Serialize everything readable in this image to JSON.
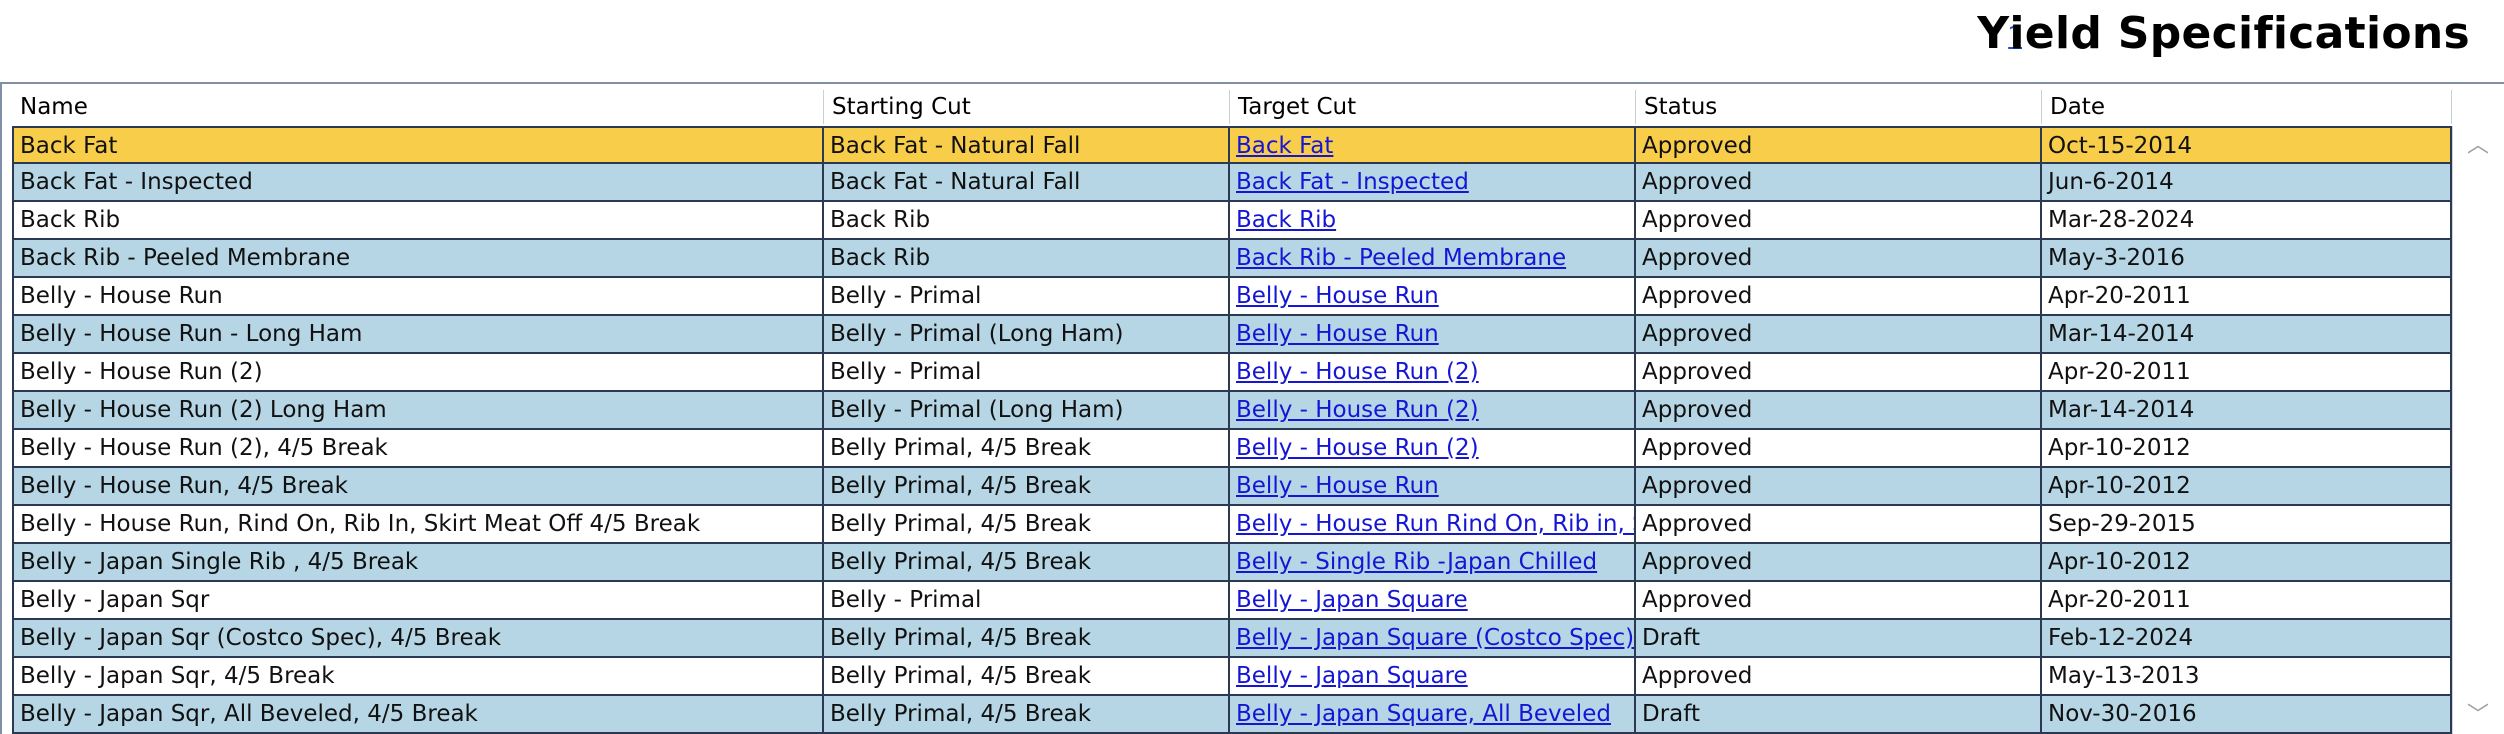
{
  "header": {
    "help_label": "?",
    "title": "Yield Specifications"
  },
  "grid": {
    "columns": [
      "Name",
      "Starting Cut",
      "Target Cut",
      "Status",
      "Date"
    ],
    "selected_row": 0,
    "rows": [
      {
        "name": "Back Fat",
        "starting_cut": "Back Fat - Natural Fall",
        "target_cut": "Back Fat",
        "status": "Approved",
        "date": "Oct-15-2014"
      },
      {
        "name": "Back Fat - Inspected",
        "starting_cut": "Back Fat - Natural Fall",
        "target_cut": "Back Fat - Inspected",
        "status": "Approved",
        "date": "Jun-6-2014"
      },
      {
        "name": "Back Rib",
        "starting_cut": "Back Rib",
        "target_cut": "Back Rib",
        "status": "Approved",
        "date": "Mar-28-2024"
      },
      {
        "name": "Back Rib - Peeled Membrane",
        "starting_cut": "Back Rib",
        "target_cut": "Back Rib - Peeled Membrane",
        "status": "Approved",
        "date": "May-3-2016"
      },
      {
        "name": "Belly - House Run",
        "starting_cut": "Belly - Primal",
        "target_cut": "Belly - House Run",
        "status": "Approved",
        "date": "Apr-20-2011"
      },
      {
        "name": "Belly - House Run - Long Ham",
        "starting_cut": "Belly - Primal (Long Ham)",
        "target_cut": "Belly - House Run",
        "status": "Approved",
        "date": "Mar-14-2014"
      },
      {
        "name": "Belly - House Run (2)",
        "starting_cut": "Belly - Primal",
        "target_cut": "Belly - House Run (2)",
        "status": "Approved",
        "date": "Apr-20-2011"
      },
      {
        "name": "Belly - House Run (2) Long Ham",
        "starting_cut": "Belly - Primal (Long Ham)",
        "target_cut": "Belly - House Run (2)",
        "status": "Approved",
        "date": "Mar-14-2014"
      },
      {
        "name": "Belly - House Run (2), 4/5 Break",
        "starting_cut": "Belly Primal, 4/5 Break",
        "target_cut": "Belly - House Run (2)",
        "status": "Approved",
        "date": "Apr-10-2012"
      },
      {
        "name": "Belly - House Run, 4/5 Break",
        "starting_cut": "Belly Primal, 4/5 Break",
        "target_cut": "Belly - House Run",
        "status": "Approved",
        "date": "Apr-10-2012"
      },
      {
        "name": "Belly - House Run, Rind On, Rib In, Skirt Meat Off 4/5 Break",
        "starting_cut": "Belly Primal, 4/5 Break",
        "target_cut": "Belly - House Run Rind On, Rib in, Skir",
        "status": "Approved",
        "date": "Sep-29-2015"
      },
      {
        "name": "Belly - Japan Single Rib , 4/5 Break",
        "starting_cut": "Belly Primal, 4/5 Break",
        "target_cut": "Belly - Single Rib -Japan Chilled",
        "status": "Approved",
        "date": "Apr-10-2012"
      },
      {
        "name": "Belly - Japan Sqr",
        "starting_cut": "Belly - Primal",
        "target_cut": "Belly - Japan Square",
        "status": "Approved",
        "date": "Apr-20-2011"
      },
      {
        "name": "Belly - Japan Sqr (Costco Spec), 4/5 Break",
        "starting_cut": "Belly Primal, 4/5 Break",
        "target_cut": "Belly - Japan Square (Costco Spec)",
        "status": "Draft",
        "date": "Feb-12-2024"
      },
      {
        "name": "Belly - Japan Sqr, 4/5 Break",
        "starting_cut": "Belly Primal, 4/5 Break",
        "target_cut": "Belly - Japan Square",
        "status": "Approved",
        "date": "May-13-2013"
      },
      {
        "name": "Belly - Japan Sqr, All Beveled, 4/5 Break",
        "starting_cut": "Belly Primal, 4/5 Break",
        "target_cut": "Belly - Japan Square, All Beveled",
        "status": "Draft",
        "date": "Nov-30-2016"
      }
    ]
  },
  "scrollbar": {
    "up_icon": "chevron-up-icon",
    "down_icon": "chevron-down-icon",
    "up_glyph": "︿",
    "down_glyph": "﹀"
  },
  "colors": {
    "selected_row": "#f8cd4a",
    "alternate_row": "#b6d6e6",
    "link": "#1515d6"
  }
}
